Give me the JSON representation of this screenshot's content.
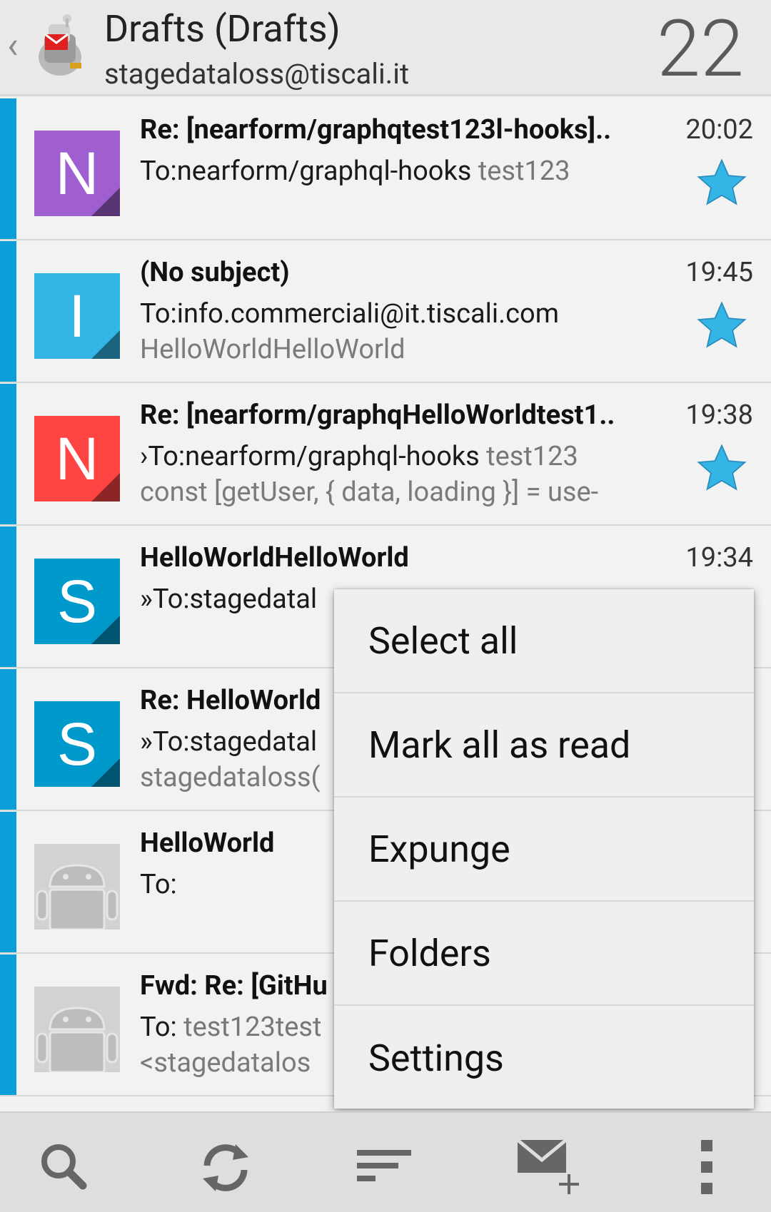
{
  "header": {
    "title": "Drafts (Drafts)",
    "account": "stagedataloss@tiscali.it",
    "count": "22",
    "back_icon": "chevron-left-icon",
    "logo_icon": "k9-mail-logo-icon"
  },
  "messages": [
    {
      "subject": "Re: [nearform/graphqtest123l-hooks]..",
      "to": "To:nearform/graphql-hooks",
      "preview_inline": " test123",
      "preview": "",
      "time": "20:02",
      "avatar_letter": "N",
      "avatar_color": "#a05fd0",
      "starred": true
    },
    {
      "subject": "(No subject)",
      "to": "To:info.commerciali@it.tiscali.com",
      "preview_inline": "",
      "preview": "HelloWorldHelloWorld",
      "time": "19:45",
      "avatar_letter": "I",
      "avatar_color": "#33b5e5",
      "starred": true
    },
    {
      "subject": "Re: [nearform/graphqHelloWorldtest1..",
      "to": "›To:nearform/graphql-hooks",
      "preview_inline": " test123",
      "preview": "const [getUser, { data, loading }] = use-",
      "time": "19:38",
      "avatar_letter": "N",
      "avatar_color": "#ff4444",
      "starred": true
    },
    {
      "subject": "HelloWorldHelloWorld",
      "to": "»To:stagedatal",
      "preview_inline": "",
      "preview": "",
      "time": "19:34",
      "avatar_letter": "S",
      "avatar_color": "#0099cc",
      "starred": false
    },
    {
      "subject": "Re: HelloWorld",
      "to": "»To:stagedatal",
      "preview_inline": "",
      "preview": "stagedataloss(",
      "time": "",
      "avatar_letter": "S",
      "avatar_color": "#0099cc",
      "starred": false
    },
    {
      "subject": "HelloWorld",
      "to": "To:",
      "preview_inline": "",
      "preview": "",
      "time": "",
      "avatar_letter": "",
      "avatar_color": "#c8c8c8",
      "starred": false
    },
    {
      "subject": "Fwd: Re: [GitHu",
      "to": "To:",
      "preview_inline": " test123test",
      "preview": "<stagedatalos",
      "time": "",
      "avatar_letter": "",
      "avatar_color": "#c8c8c8",
      "starred": false
    }
  ],
  "menu": {
    "items": [
      "Select all",
      "Mark all as read",
      "Expunge",
      "Folders",
      "Settings"
    ]
  },
  "toolbar": {
    "icons": [
      "search-icon",
      "refresh-icon",
      "sort-icon",
      "compose-icon",
      "overflow-menu-icon"
    ]
  },
  "colors": {
    "accent": "#0a9fd8",
    "star": "#33b5e5"
  }
}
